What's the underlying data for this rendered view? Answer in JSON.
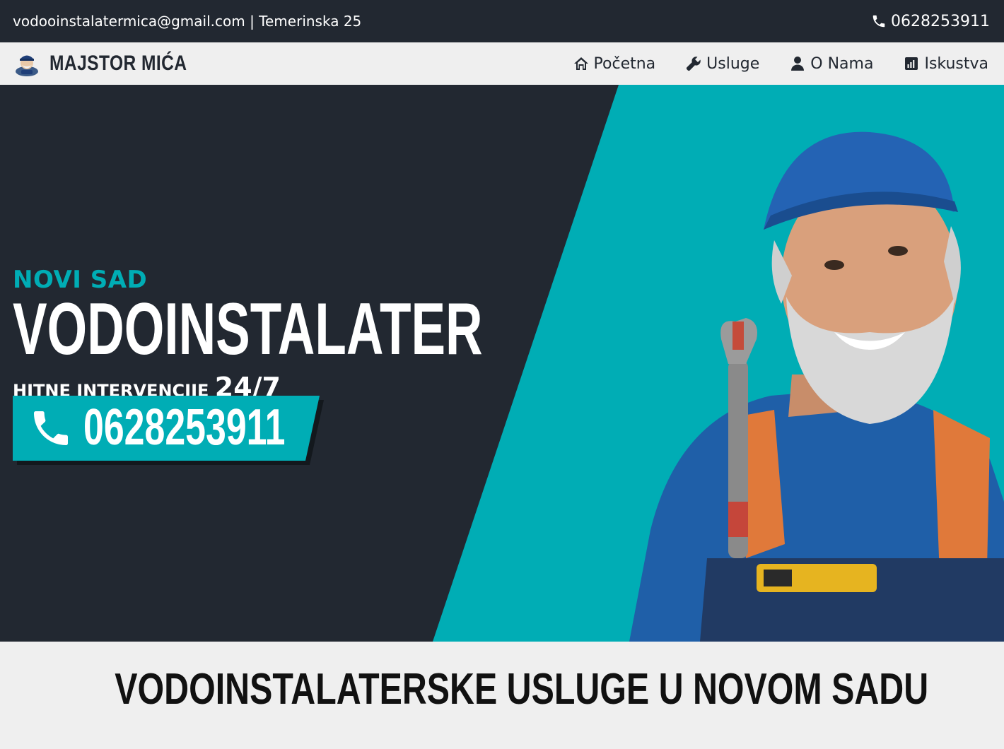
{
  "topbar": {
    "contact": "vodooinstalatermica@gmail.com | Temerinska 25",
    "phone": "0628253911"
  },
  "brand": {
    "name": "MAJSTOR MIĆA"
  },
  "nav": [
    {
      "label": "Početna",
      "icon": "home-icon"
    },
    {
      "label": "Usluge",
      "icon": "wrench-icon"
    },
    {
      "label": "O Nama",
      "icon": "user-icon"
    },
    {
      "label": "Iskustva",
      "icon": "chart-icon"
    }
  ],
  "hero": {
    "city": "NOVI SAD",
    "headline": "VODOINSTALATER",
    "tagline": "HITNE INTERVENCIJE",
    "tagline_big": "24/7",
    "cta_phone": "0628253911"
  },
  "section": {
    "title": "VODOINSTALATERSKE USLUGE U NOVOM SADU"
  },
  "colors": {
    "dark": "#222831",
    "accent": "#00adb5",
    "light": "#efefef"
  }
}
